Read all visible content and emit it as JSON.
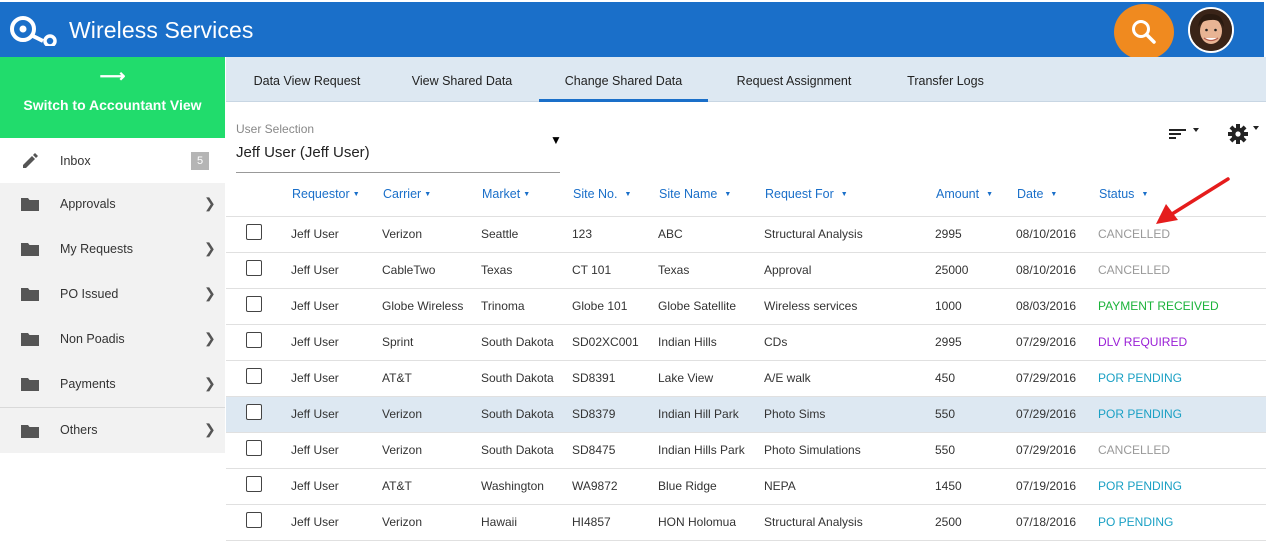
{
  "app": {
    "title": "Wireless Services"
  },
  "colors": {
    "header": "#1a6fc9",
    "search": "#f08a1f",
    "switch": "#21dc6c",
    "cancelled": "#999999",
    "payment": "#1bb33a",
    "dlv": "#9a1fd6",
    "pending": "#1aa0c4"
  },
  "sidebar": {
    "switch_arrow": "⟶",
    "switch_label": "Switch to Accountant View",
    "items": [
      {
        "label": "Inbox",
        "icon": "pencil-icon",
        "badge": "5"
      },
      {
        "label": "Approvals",
        "icon": "folder-icon"
      },
      {
        "label": "My Requests",
        "icon": "folder-icon"
      },
      {
        "label": "PO Issued",
        "icon": "folder-icon"
      },
      {
        "label": "Non Poadis",
        "icon": "folder-icon"
      },
      {
        "label": "Payments",
        "icon": "folder-icon"
      },
      {
        "label": "Others",
        "icon": "folder-icon"
      }
    ]
  },
  "tabs": [
    {
      "label": "Data View Request"
    },
    {
      "label": "View Shared Data"
    },
    {
      "label": "Change Shared Data",
      "active": true
    },
    {
      "label": "Request Assignment"
    },
    {
      "label": "Transfer Logs"
    }
  ],
  "selection": {
    "label": "User Selection",
    "value": "Jeff User (Jeff User)"
  },
  "table": {
    "headers": [
      "Requestor",
      "Carrier",
      "Market",
      "Site No.",
      "Site Name",
      "Request For",
      "Amount",
      "Date",
      "Status"
    ],
    "rows": [
      [
        "Jeff User",
        "Verizon",
        "Seattle",
        "123",
        "ABC",
        "Structural Analysis",
        "2995",
        "08/10/2016",
        "CANCELLED"
      ],
      [
        "Jeff User",
        "CableTwo",
        "Texas",
        "CT 101",
        "Texas",
        "Approval",
        "25000",
        "08/10/2016",
        "CANCELLED"
      ],
      [
        "Jeff User",
        "Globe Wireless",
        "Trinoma",
        "Globe 101",
        "Globe Satellite",
        "Wireless services",
        "1000",
        "08/03/2016",
        "PAYMENT RECEIVED"
      ],
      [
        "Jeff User",
        "Sprint",
        "South Dakota",
        "SD02XC001",
        "Indian Hills",
        "CDs",
        "2995",
        "07/29/2016",
        "DLV REQUIRED"
      ],
      [
        "Jeff User",
        "AT&T",
        "South Dakota",
        "SD8391",
        "Lake View",
        "A/E walk",
        "450",
        "07/29/2016",
        "POR PENDING"
      ],
      [
        "Jeff User",
        "Verizon",
        "South Dakota",
        "SD8379",
        "Indian Hill Park",
        "Photo Sims",
        "550",
        "07/29/2016",
        "POR PENDING"
      ],
      [
        "Jeff User",
        "Verizon",
        "South Dakota",
        "SD8475",
        "Indian Hills Park",
        "Photo Simulations",
        "550",
        "07/29/2016",
        "CANCELLED"
      ],
      [
        "Jeff User",
        "AT&T",
        "Washington",
        "WA9872",
        "Blue Ridge",
        "NEPA",
        "1450",
        "07/19/2016",
        "POR PENDING"
      ],
      [
        "Jeff User",
        "Verizon",
        "Hawaii",
        "HI4857",
        "HON Holomua",
        "Structural Analysis",
        "2500",
        "07/18/2016",
        "PO PENDING"
      ]
    ],
    "highlighted_row": 5
  }
}
